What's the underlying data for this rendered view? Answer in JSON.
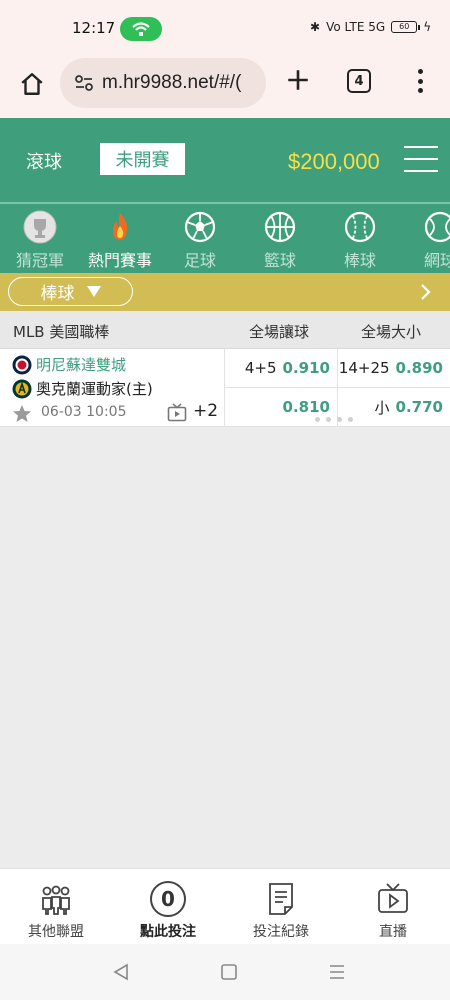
{
  "status_bar": {
    "time": "12:17",
    "network_text": "Vo LTE  5G",
    "battery": "60"
  },
  "browser": {
    "url": "m.hr9988.net/#/(",
    "tab_count": "4"
  },
  "header": {
    "live_tab": "滾球",
    "upcoming_tab": "未開賽",
    "balance": "$200,000"
  },
  "categories": [
    {
      "label": "猜冠軍",
      "icon": "trophy-icon"
    },
    {
      "label": "熱門賽事",
      "icon": "fire-icon"
    },
    {
      "label": "足球",
      "icon": "soccer-ball-icon"
    },
    {
      "label": "籃球",
      "icon": "basketball-icon"
    },
    {
      "label": "棒球",
      "icon": "baseball-icon"
    },
    {
      "label": "網球",
      "icon": "tennis-ball-icon"
    }
  ],
  "filter": {
    "selected": "棒球"
  },
  "table_header": {
    "league": "MLB 美國職棒",
    "col1": "全場讓球",
    "col2": "全場大小"
  },
  "match": {
    "home_team": "明尼蘇達雙城",
    "away_team": "奧克蘭運動家(主)",
    "datetime": "06-03 10:05",
    "more_markets": "+2",
    "handicap": {
      "line": "4+5",
      "home_price": "0.910",
      "away_price": "0.810"
    },
    "total": {
      "line": "14+25",
      "over_price": "0.890",
      "under_label": "小",
      "under_price": "0.770"
    }
  },
  "bottom_nav": [
    {
      "label": "其他聯盟",
      "icon": "people-icon"
    },
    {
      "label": "點此投注",
      "count": "0"
    },
    {
      "label": "投注紀錄",
      "icon": "document-icon"
    },
    {
      "label": "直播",
      "icon": "tv-play-icon"
    }
  ],
  "colors": {
    "primary_green": "#3f9f7c",
    "balance_yellow": "#f7df47",
    "filter_bar": "#d2bd55"
  }
}
